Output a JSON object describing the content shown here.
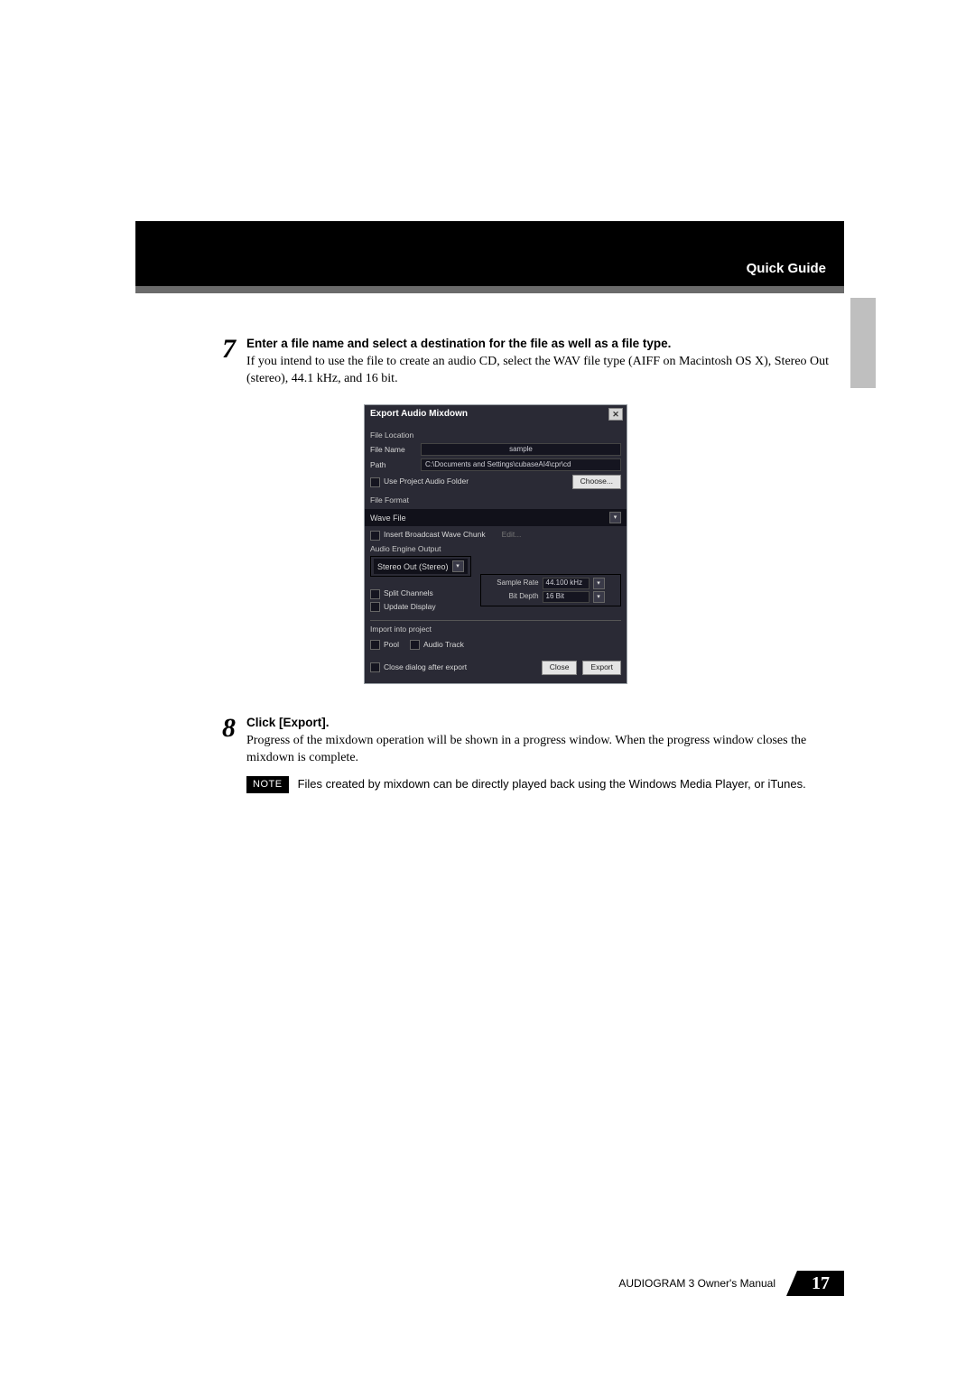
{
  "header": {
    "title": "Quick Guide"
  },
  "footer": {
    "text": "AUDIOGRAM 3 Owner's Manual",
    "page": "17"
  },
  "steps": [
    {
      "num": "7",
      "title": "Enter a file name and select a destination for the file as well as a file type.",
      "desc": "If you intend to use the file to create an audio CD, select the WAV file type (AIFF on Macintosh OS X), Stereo Out (stereo), 44.1 kHz, and 16 bit."
    },
    {
      "num": "8",
      "title": "Click [Export].",
      "desc": "Progress of the mixdown operation will be shown in a progress window. When the progress window closes the mixdown is complete."
    }
  ],
  "note": {
    "badge": "NOTE",
    "text": "Files created by mixdown can be directly played back using the Windows Media Player, or iTunes."
  },
  "dialog": {
    "title": "Export Audio Mixdown",
    "file_location_label": "File Location",
    "file_name_label": "File Name",
    "file_name_value": "sample",
    "path_label": "Path",
    "path_value": "C:\\Documents and Settings\\cubaseAI4\\cpr\\cd",
    "use_project_folder": "Use Project Audio Folder",
    "choose_btn": "Choose...",
    "file_format_label": "File Format",
    "wave_file": "Wave File",
    "insert_bwave": "Insert Broadcast Wave Chunk",
    "edit_btn": "Edit...",
    "audio_engine_label": "Audio Engine Output",
    "stereo_out": "Stereo Out (Stereo)",
    "sample_rate_label": "Sample Rate",
    "sample_rate_value": "44.100 kHz",
    "bit_depth_label": "Bit Depth",
    "bit_depth_value": "16 Bit",
    "split_channels": "Split Channels",
    "update_display": "Update Display",
    "import_label": "Import into project",
    "pool": "Pool",
    "audio_track": "Audio Track",
    "close_after": "Close dialog after export",
    "close_btn": "Close",
    "export_btn": "Export"
  }
}
